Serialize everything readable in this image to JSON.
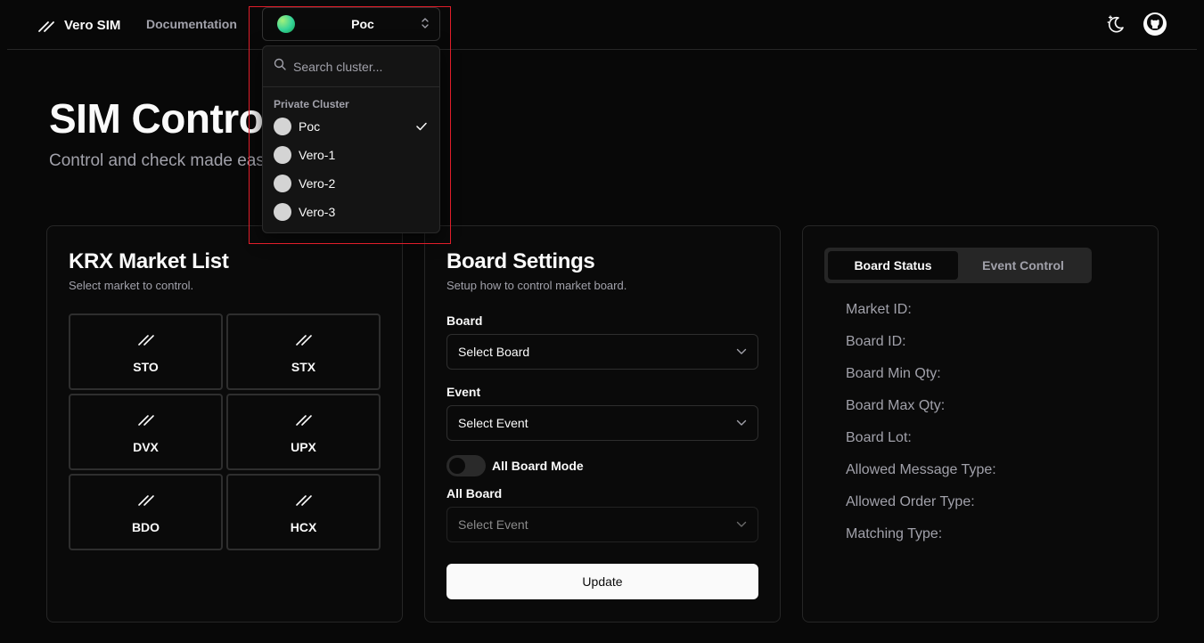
{
  "nav": {
    "brand": "Vero SIM",
    "docs_link": "Documentation",
    "cluster_selected": "Poc"
  },
  "cluster_dropdown": {
    "search_placeholder": "Search cluster...",
    "group_label": "Private Cluster",
    "items": [
      {
        "name": "Poc",
        "selected": true
      },
      {
        "name": "Vero-1",
        "selected": false
      },
      {
        "name": "Vero-2",
        "selected": false
      },
      {
        "name": "Vero-3",
        "selected": false
      }
    ]
  },
  "hero": {
    "title": "SIM Control",
    "subtitle": "Control and check made easy"
  },
  "market_list": {
    "title": "KRX Market List",
    "description": "Select market to control.",
    "markets": [
      "STO",
      "STX",
      "DVX",
      "UPX",
      "BDO",
      "HCX"
    ]
  },
  "board_settings": {
    "title": "Board Settings",
    "description": "Setup how to control market board.",
    "board_label": "Board",
    "board_placeholder": "Select Board",
    "event_label": "Event",
    "event_placeholder": "Select Event",
    "all_board_mode_label": "All Board Mode",
    "all_board_label": "All Board",
    "all_board_placeholder": "Select Event",
    "update_label": "Update"
  },
  "status_panel": {
    "tabs": [
      "Board Status",
      "Event Control"
    ],
    "active_tab": "Board Status",
    "fields": [
      "Market ID:",
      "Board ID:",
      "Board Min Qty:",
      "Board Max Qty:",
      "Board Lot:",
      "Allowed Message Type:",
      "Allowed Order Type:",
      "Matching Type:"
    ]
  },
  "colors": {
    "background": "#080808",
    "card": "#0a0a0a",
    "border": "#262626",
    "highlight": "#e11d2a",
    "cluster_dot": "#34d399"
  }
}
